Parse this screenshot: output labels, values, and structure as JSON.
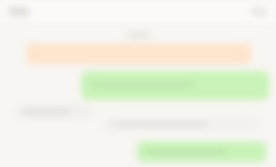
{
  "app": {
    "title": "",
    "theme": {
      "background": "#f8f6f3",
      "header_background": "#fbfaf8",
      "notice_color": "#fde4cc",
      "outgoing_bubble_color": "#c9f3b8",
      "incoming_bubble_color": "#f1efeb"
    }
  },
  "header": {
    "logo_icon": "logo-icon",
    "action_icon": "menu-icon"
  },
  "chat": {
    "timestamp": "",
    "notice": {
      "text": ""
    },
    "messages": [
      {
        "direction": "outgoing",
        "text": ""
      },
      {
        "direction": "incoming",
        "text": ""
      },
      {
        "direction": "incoming",
        "text": ""
      },
      {
        "direction": "outgoing",
        "text": ""
      }
    ]
  }
}
